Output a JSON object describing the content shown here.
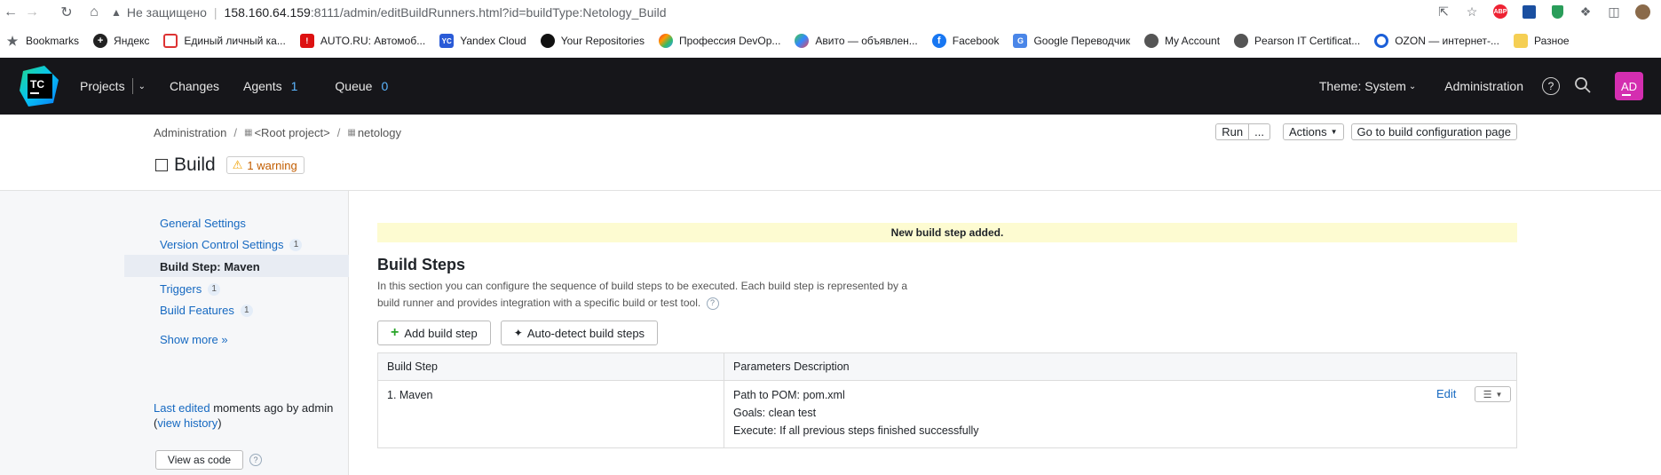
{
  "browser": {
    "security_text": "Не защищено",
    "url_host": "158.160.64.159",
    "url_path": ":8111/admin/editBuildRunners.html?id=buildType:Netology_Build"
  },
  "bookmarks": [
    {
      "label": "Bookmarks",
      "icon": "star-icon"
    },
    {
      "label": "Яндекс",
      "icon": "plus-icon"
    },
    {
      "label": "Единый личный ка...",
      "icon": "chat-icon"
    },
    {
      "label": "AUTO.RU: Автомоб...",
      "icon": "auto-icon"
    },
    {
      "label": "Yandex Cloud",
      "icon": "yc-icon"
    },
    {
      "label": "Your Repositories",
      "icon": "github-icon"
    },
    {
      "label": "Профессия DevOp...",
      "icon": "dots-icon"
    },
    {
      "label": "Авито — объявлен...",
      "icon": "avito-icon"
    },
    {
      "label": "Facebook",
      "icon": "facebook-icon"
    },
    {
      "label": "Google Переводчик",
      "icon": "translate-icon"
    },
    {
      "label": "My Account",
      "icon": "account-icon"
    },
    {
      "label": "Pearson IT Certificat...",
      "icon": "pearson-icon"
    },
    {
      "label": "OZON — интернет-...",
      "icon": "ozon-icon"
    },
    {
      "label": "Разное",
      "icon": "folder-icon"
    }
  ],
  "header": {
    "projects": "Projects",
    "changes": "Changes",
    "agents": "Agents",
    "agents_count": "1",
    "queue": "Queue",
    "queue_count": "0",
    "theme": "Theme: System",
    "administration": "Administration",
    "avatar_initials": "AD"
  },
  "breadcrumb": {
    "admin": "Administration",
    "root": "<Root project>",
    "project": "netology"
  },
  "page": {
    "title": "Build",
    "warning": "1 warning",
    "run": "Run",
    "run_more": "...",
    "actions": "Actions",
    "goto": "Go to build configuration page"
  },
  "sidebar": {
    "items": [
      {
        "label": "General Settings",
        "count": ""
      },
      {
        "label": "Version Control Settings",
        "count": "1"
      },
      {
        "label": "Build Step: Maven",
        "count": ""
      },
      {
        "label": "Triggers",
        "count": "1"
      },
      {
        "label": "Build Features",
        "count": "1"
      }
    ],
    "show_more": "Show more »",
    "last_edited_pre": "Last edited",
    "last_edited_post": " moments ago by admin",
    "view_history_pre": "(",
    "view_history": "view history",
    "view_history_post": ")",
    "view_as_code": "View as code"
  },
  "main": {
    "notice": "New build step added.",
    "heading": "Build Steps",
    "description": "In this section you can configure the sequence of build steps to be executed. Each build step is represented by a build runner and provides integration with a specific build or test tool.",
    "add_step": "Add build step",
    "auto_detect": "Auto-detect build steps",
    "table": {
      "col1": "Build Step",
      "col2": "Parameters Description",
      "rows": [
        {
          "step": "1. Maven",
          "params": [
            "Path to POM: pom.xml",
            "Goals: clean test",
            "Execute: If all previous steps finished successfully"
          ],
          "edit": "Edit"
        }
      ]
    }
  }
}
